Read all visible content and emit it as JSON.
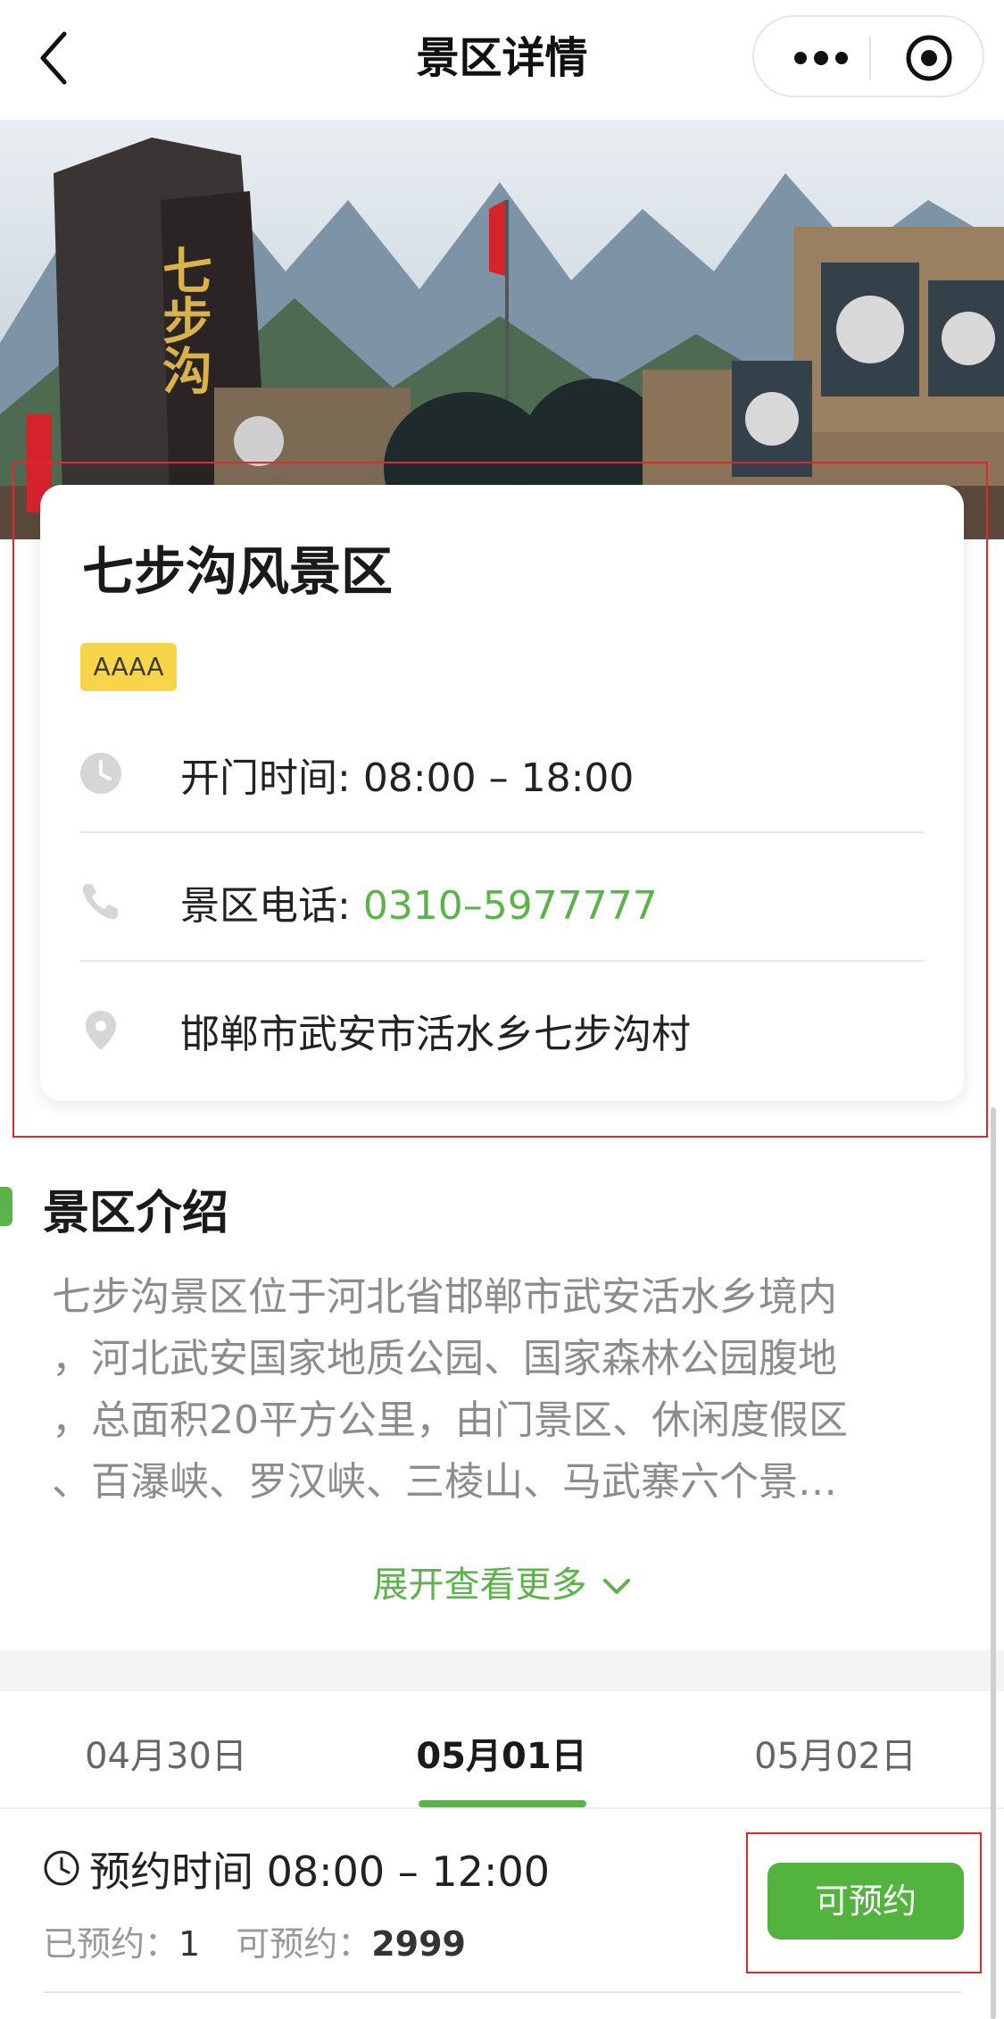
{
  "header": {
    "title": "景区详情"
  },
  "banner": {
    "sign_text": "七步沟"
  },
  "scenic": {
    "name": "七步沟风景区",
    "rating_badge": "AAAA",
    "hours_label": "开门时间: ",
    "hours_value": "08:00 – 18:00",
    "phone_label": "景区电话: ",
    "phone_value": "0310–5977777",
    "address": "邯郸市武安市活水乡七步沟村"
  },
  "intro": {
    "title": "景区介绍",
    "lines": [
      "七步沟景区位于河北省邯郸市武安活水乡境内",
      "，河北武安国家地质公园、国家森林公园腹地",
      "，总面积20平方公里，由门景区、休闲度假区",
      "、百瀑峡、罗汉峡、三棱山、马武寨六个景…"
    ],
    "expand_label": "展开查看更多"
  },
  "dates": {
    "tabs": [
      {
        "label": "04月30日",
        "active": false
      },
      {
        "label": "05月01日",
        "active": true
      },
      {
        "label": "05月02日",
        "active": false
      }
    ]
  },
  "slot": {
    "time_label": "预约时间 ",
    "time_value": "08:00 – 12:00",
    "booked_label": "已预约：",
    "booked_value": "1",
    "available_label": "可预约：",
    "available_value": "2999",
    "button_label": "可预约"
  },
  "colors": {
    "accent_green": "#5bb34a",
    "badge_yellow": "#f7d54a",
    "highlight_red": "#e0292f"
  }
}
